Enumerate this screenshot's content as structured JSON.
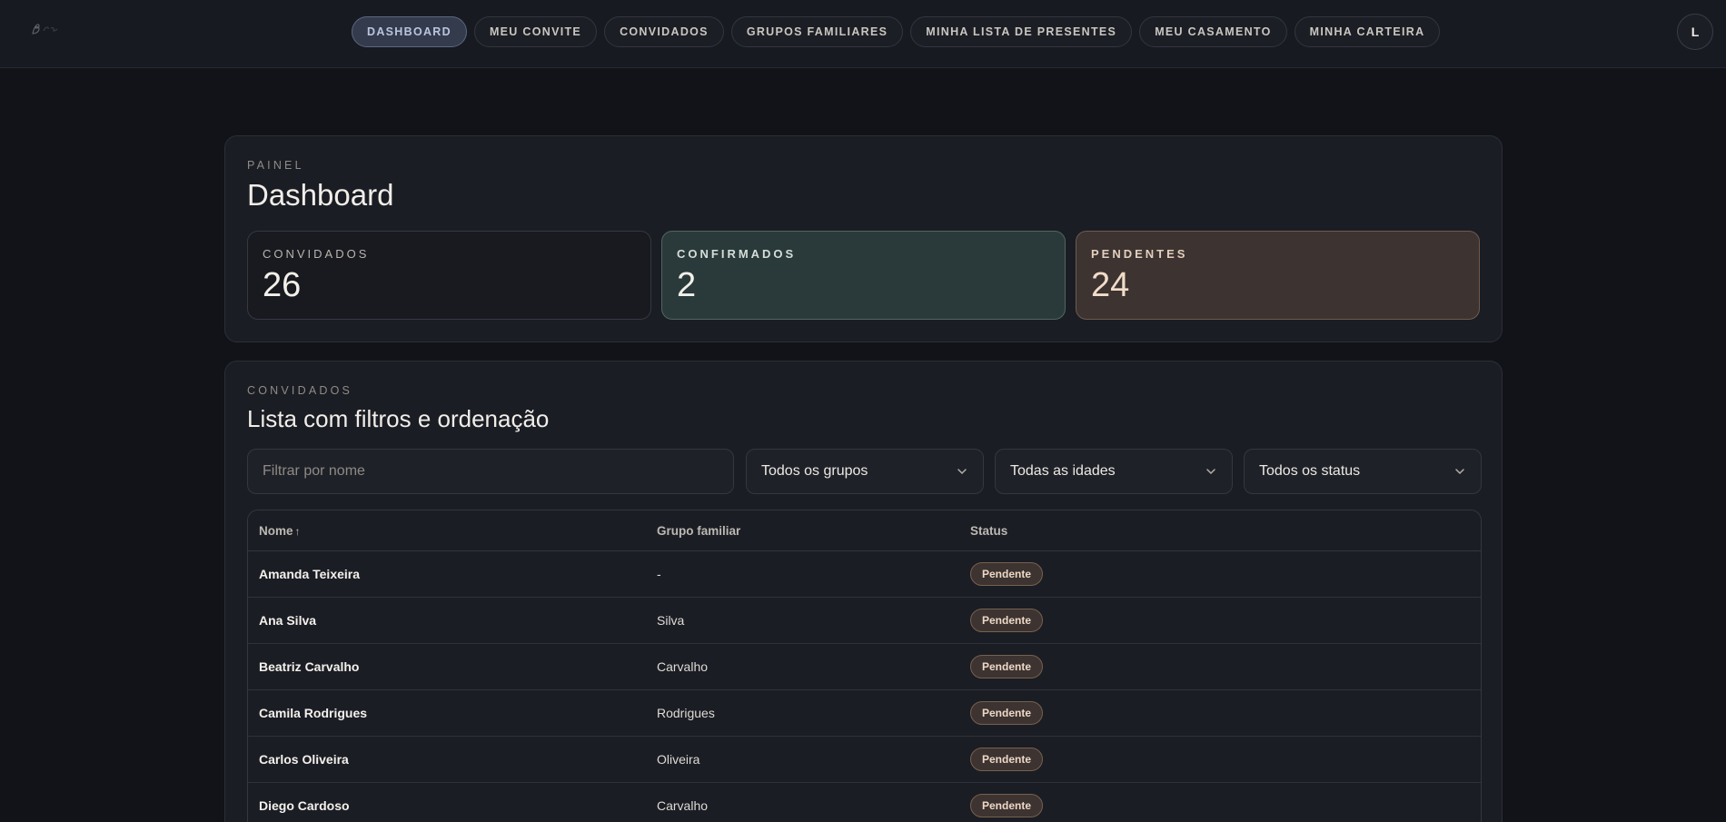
{
  "nav": {
    "items": [
      {
        "label": "DASHBOARD",
        "active": true
      },
      {
        "label": "MEU CONVITE",
        "active": false
      },
      {
        "label": "CONVIDADOS",
        "active": false
      },
      {
        "label": "GRUPOS FAMILIARES",
        "active": false
      },
      {
        "label": "MINHA LISTA DE PRESENTES",
        "active": false
      },
      {
        "label": "MEU CASAMENTO",
        "active": false
      },
      {
        "label": "MINHA CARTEIRA",
        "active": false
      }
    ],
    "avatar_initial": "L"
  },
  "dashboard": {
    "eyebrow": "PAINEL",
    "title": "Dashboard",
    "stats": [
      {
        "label": "CONVIDADOS",
        "value": "26"
      },
      {
        "label": "CONFIRMADOS",
        "value": "2"
      },
      {
        "label": "PENDENTES",
        "value": "24"
      }
    ]
  },
  "guests": {
    "eyebrow": "CONVIDADOS",
    "title": "Lista com filtros e ordenação",
    "filters": {
      "name_placeholder": "Filtrar por nome",
      "group_selected": "Todos os grupos",
      "age_selected": "Todas as idades",
      "status_selected": "Todos os status"
    },
    "columns": {
      "name": "Nome",
      "group": "Grupo familiar",
      "status": "Status"
    },
    "rows": [
      {
        "name": "Amanda Teixeira",
        "group": "-",
        "status": "Pendente"
      },
      {
        "name": "Ana Silva",
        "group": "Silva",
        "status": "Pendente"
      },
      {
        "name": "Beatriz Carvalho",
        "group": "Carvalho",
        "status": "Pendente"
      },
      {
        "name": "Camila Rodrigues",
        "group": "Rodrigues",
        "status": "Pendente"
      },
      {
        "name": "Carlos Oliveira",
        "group": "Oliveira",
        "status": "Pendente"
      },
      {
        "name": "Diego Cardoso",
        "group": "Carvalho",
        "status": "Pendente"
      }
    ]
  },
  "colors": {
    "background": "#121318",
    "card": "#1b1d24",
    "confirmed": "#2a3a3a",
    "pending": "#3d3330",
    "accent_active": "#343b4d"
  }
}
